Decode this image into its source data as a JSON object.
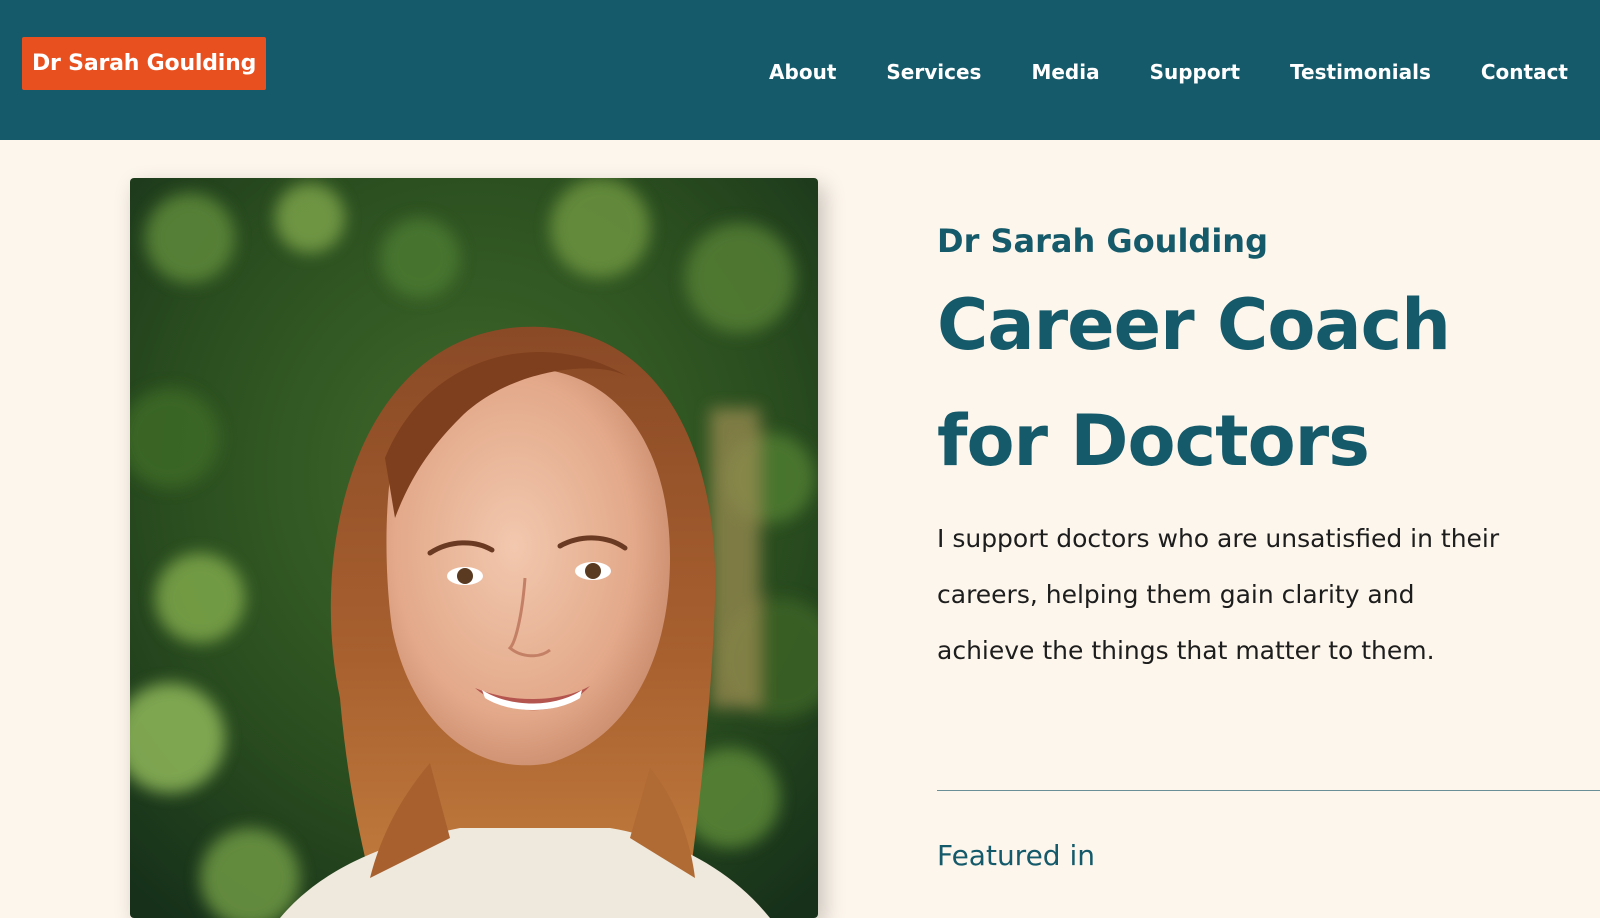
{
  "header": {
    "logo_text": "Dr Sarah Goulding",
    "nav": [
      {
        "label": "About"
      },
      {
        "label": "Services"
      },
      {
        "label": "Media"
      },
      {
        "label": "Support"
      },
      {
        "label": "Testimonials"
      },
      {
        "label": "Contact"
      }
    ]
  },
  "hero": {
    "name": "Dr Sarah Goulding",
    "title_line1": "Career Coach",
    "title_line2": "for Doctors",
    "description": "I support doctors who are unsatisfied in their careers, helping them gain clarity and achieve the things that matter to them.",
    "featured_heading": "Featured in"
  },
  "colors": {
    "header_bg": "#155a6a",
    "logo_bg": "#e8501f",
    "page_bg": "#fdf6ec",
    "heading": "#155a6a",
    "body_text": "#1d1d1d"
  }
}
